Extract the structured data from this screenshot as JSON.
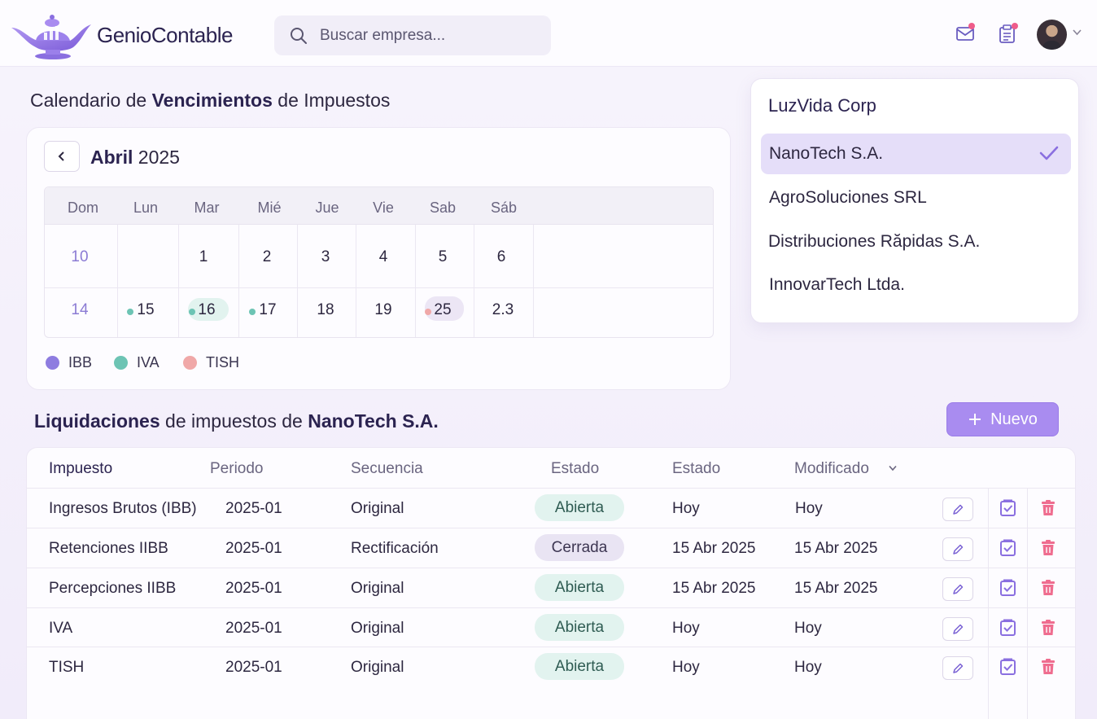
{
  "header": {
    "brand": "GenioContable",
    "search_placeholder": "Buscar empresa..."
  },
  "calendar": {
    "title_pre": "Calendario de ",
    "title_bold": "Vencimientos",
    "title_post": " de Impuestos",
    "month": "Abril",
    "year": "2025",
    "weekdays": [
      "Dom",
      "Lun",
      "Mar",
      "Mié",
      "Jue",
      "Vie",
      "Sab",
      "Sáb"
    ],
    "week1": [
      "10",
      "",
      "1",
      "2",
      "3",
      "4",
      "5",
      "6"
    ],
    "week2": [
      "14",
      "15",
      "16",
      "17",
      "18",
      "19",
      "25",
      "2.3"
    ],
    "legend": [
      {
        "label": "IBB",
        "color": "#8e7ce0"
      },
      {
        "label": "IVA",
        "color": "#6dc4b4"
      },
      {
        "label": "TISH",
        "color": "#f0a8a8"
      }
    ]
  },
  "company_dropdown": {
    "header": "LuzVida Corp",
    "items": [
      {
        "label": "NanoTech S.A.",
        "selected": true
      },
      {
        "label": "AgroSoluciones SRL",
        "selected": false
      },
      {
        "label": "Distribuciones Răpidas S.A.",
        "selected": false
      },
      {
        "label": "InnovarTech Ltda.",
        "selected": false
      }
    ]
  },
  "liquidaciones": {
    "title_bold1": "Liquidaciones",
    "title_mid": " de impuestos de ",
    "title_bold2": "NanoTech S.A.",
    "new_button": "Nuevo",
    "columns": [
      "Impuesto",
      "Periodo",
      "Secuencia",
      "Estado",
      "Estado",
      "Modificado"
    ],
    "rows": [
      {
        "impuesto": "Ingresos Brutos (IBB)",
        "periodo": "2025-01",
        "secuencia": "Original",
        "estado": "Abierta",
        "estado2": "Hoy",
        "modificado": "Hoy"
      },
      {
        "impuesto": "Retenciones IIBB",
        "periodo": "2025-01",
        "secuencia": "Rectificación",
        "estado": "Cerrada",
        "estado2": "15 Abr 2025",
        "modificado": "15 Abr 2025"
      },
      {
        "impuesto": "Percepciones IIBB",
        "periodo": "2025-01",
        "secuencia": "Original",
        "estado": "Abierta",
        "estado2": "15 Abr 2025",
        "modificado": "15 Abr 2025"
      },
      {
        "impuesto": "IVA",
        "periodo": "2025-01",
        "secuencia": "Original",
        "estado": "Abierta",
        "estado2": "Hoy",
        "modificado": "Hoy"
      },
      {
        "impuesto": "TISH",
        "periodo": "2025-01",
        "secuencia": "Original",
        "estado": "Abierta",
        "estado2": "Hoy",
        "modificado": "Hoy"
      }
    ]
  },
  "colors": {
    "accent": "#a98cf0",
    "open_badge": "#e2f3ef",
    "closed_badge": "#e9e4f3",
    "delete": "#ef6d8f",
    "approve": "#8a6fe0"
  }
}
